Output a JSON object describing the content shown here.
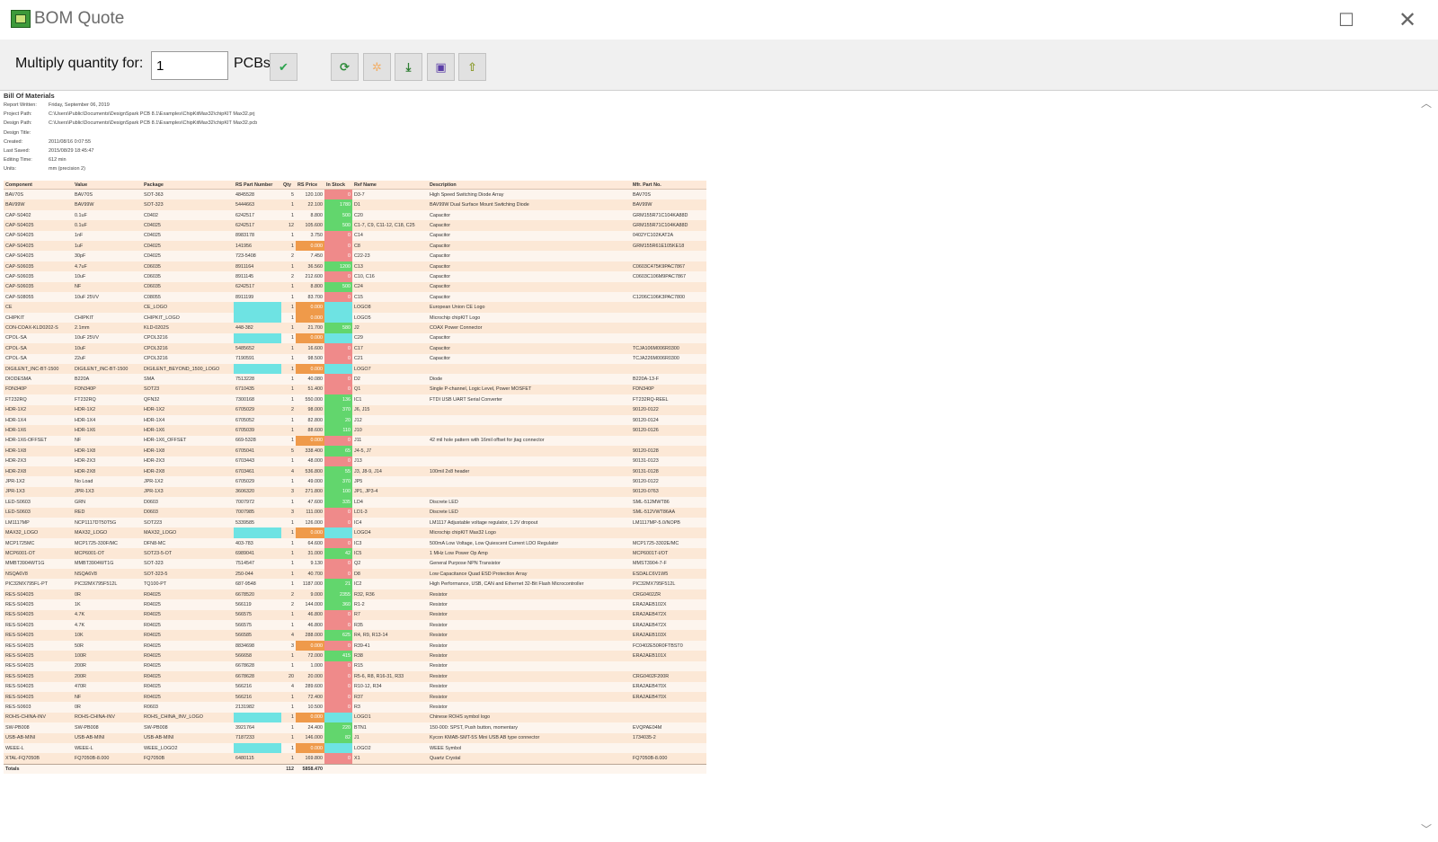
{
  "window": {
    "title": "BOM Quote"
  },
  "toolbar": {
    "multiply_label": "Multiply quantity for:",
    "quantity_value": "1",
    "pcbs_label": "PCBs"
  },
  "colors": {
    "toolbar_bg": "#f0f0f0",
    "header_bg": "#fde9d9",
    "stock_zero": "#ef8a8a",
    "stock_ok": "#62d66d",
    "missing": "#6ee3e3",
    "price_zero": "#ef9a4a"
  },
  "report": {
    "title": "Bill Of Materials",
    "meta": [
      {
        "k": "Report Written:",
        "v": "Friday, September 06, 2019"
      },
      {
        "k": "Project Path:",
        "v": "C:\\Users\\Public\\Documents\\DesignSpark PCB 8.1\\Examples\\ChipKitMax32\\chipKIT Max32.prj"
      },
      {
        "k": "Design Path:",
        "v": "C:\\Users\\Public\\Documents\\DesignSpark PCB 8.1\\Examples\\ChipKitMax32\\chipKIT Max32.pcb"
      },
      {
        "k": "Design Title:",
        "v": ""
      },
      {
        "k": "Created:",
        "v": "2011/08/16 0:07:55"
      },
      {
        "k": "Last Saved:",
        "v": "2015/08/29 18:45:47"
      },
      {
        "k": "Editing Time:",
        "v": "612 min"
      },
      {
        "k": "Units:",
        "v": "mm (precision 2)"
      }
    ]
  },
  "table": {
    "headers": [
      "Component",
      "Value",
      "Package",
      "RS Part Number",
      "Qty",
      "RS Price",
      "In Stock",
      "Ref Name",
      "Description",
      "Mfr. Part No."
    ],
    "rows": [
      [
        "BAV70S",
        "BAV70S",
        "SOT-363",
        "4845528",
        "5",
        "120.100",
        "0",
        "D3-7",
        "High Speed Switching Diode Array",
        "BAV70S"
      ],
      [
        "BAV99W",
        "BAV99W",
        "SOT-323",
        "5444663",
        "1",
        "22.100",
        "1780",
        "D1",
        "BAV99W Dual Surface Mount Switching Diode",
        "BAV99W"
      ],
      [
        "CAP-S0402",
        "0.1uF",
        "C0402",
        "6242517",
        "1",
        "8.800",
        "500",
        "C20",
        "Capacitor",
        "GRM155R71C104KA88D"
      ],
      [
        "CAP-S04025",
        "0.1uF",
        "C04025",
        "6242517",
        "12",
        "105.600",
        "500",
        "C1-7, C9, C11-12, C18, C25",
        "Capacitor",
        "GRM155R71C104KA88D"
      ],
      [
        "CAP-S04025",
        "1nF",
        "C04025",
        "8983178",
        "1",
        "3.750",
        "0",
        "C14",
        "Capacitor",
        "0402YC102KAT2A"
      ],
      [
        "CAP-S04025",
        "1uF",
        "C04025",
        "141956",
        "1",
        "0.000",
        "0",
        "C8",
        "Capacitor",
        "GRM155R61E105KE18"
      ],
      [
        "CAP-S04025",
        "30pF",
        "C04025",
        "723-5408",
        "2",
        "7.450",
        "0",
        "C22-23",
        "Capacitor",
        ""
      ],
      [
        "CAP-S06035",
        "4.7uF",
        "C06035",
        "8911164",
        "1",
        "36.560",
        "1200",
        "C13",
        "Capacitor",
        "C0603C475K9PAC7867"
      ],
      [
        "CAP-S06035",
        "10uF",
        "C06035",
        "8911145",
        "2",
        "212.600",
        "0",
        "C10, C16",
        "Capacitor",
        "C0603C106M9PAC7867"
      ],
      [
        "CAP-S06035",
        "NF",
        "C06035",
        "6242517",
        "1",
        "8.800",
        "500",
        "C24",
        "Capacitor",
        ""
      ],
      [
        "CAP-S08055",
        "10uF 25VV",
        "C08055",
        "8911199",
        "1",
        "83.700",
        "0",
        "C15",
        "Capacitor",
        "C1206C106K3PAC7800"
      ],
      [
        "CE",
        "",
        "CE_LOGO",
        "",
        "1",
        "0.000",
        "",
        "LOGO8",
        "European Union CE Logo",
        ""
      ],
      [
        "CHIPKIT",
        "CHIPKIT",
        "CHIPKIT_LOGO",
        "",
        "1",
        "0.000",
        "",
        "LOGO5",
        "Microchip chipKIT Logo",
        ""
      ],
      [
        "CON-COAX-KLD0202-S",
        "2.1mm",
        "KLD-0202S",
        "448-382",
        "1",
        "21.700",
        "580",
        "J2",
        "COAX Power Connector",
        ""
      ],
      [
        "CPOL-SA",
        "10uF 25VV",
        "CPOL3216",
        "",
        "1",
        "0.000",
        "",
        "C29",
        "Capacitor",
        ""
      ],
      [
        "CPOL-SA",
        "10uF",
        "CPOL3216",
        "5485652",
        "1",
        "16.600",
        "0",
        "C17",
        "Capacitor",
        "TCJA106M006R0300"
      ],
      [
        "CPOL-SA",
        "22uF",
        "CPOL3216",
        "7190591",
        "1",
        "98.500",
        "0",
        "C21",
        "Capacitor",
        "TCJA226M006R0300"
      ],
      [
        "DIGILENT_INC-BT-1500",
        "DIGILENT_INC-BT-1500",
        "DIGILENT_BEYOND_1500_LOGO",
        "",
        "1",
        "0.000",
        "",
        "LOGO7",
        "",
        ""
      ],
      [
        "DIODESMA",
        "B220A",
        "SMA",
        "7513228",
        "1",
        "40.080",
        "0",
        "D2",
        "Diode",
        "B220A-13-F"
      ],
      [
        "FDN340P",
        "FDN340P",
        "SOT23",
        "6710435",
        "1",
        "51.400",
        "0",
        "Q1",
        "Single P-channel, Logic Level, Power MOSFET",
        "FDN340P"
      ],
      [
        "FT232RQ",
        "FT232RQ",
        "QFN32",
        "7300168",
        "1",
        "550.000",
        "136",
        "IC1",
        "FTDI USB UART Serial Converter",
        "FT232RQ-REEL"
      ],
      [
        "HDR-1X2",
        "HDR-1X2",
        "HDR-1X2",
        "6705029",
        "2",
        "98.000",
        "370",
        "J6, J15",
        "",
        "90120-0122"
      ],
      [
        "HDR-1X4",
        "HDR-1X4",
        "HDR-1X4",
        "6705052",
        "1",
        "82.800",
        "20",
        "J12",
        "",
        "90120-0124"
      ],
      [
        "HDR-1X6",
        "HDR-1X6",
        "HDR-1X6",
        "6705039",
        "1",
        "88.600",
        "110",
        "J10",
        "",
        "90120-0126"
      ],
      [
        "HDR-1X6-OFFSET",
        "NF",
        "HDR-1X6_OFFSET",
        "669-5328",
        "1",
        "0.000",
        "0",
        "J11",
        "42 mil hole pattern with 16mil offset for jtag connector",
        ""
      ],
      [
        "HDR-1X8",
        "HDR-1X8",
        "HDR-1X8",
        "6705041",
        "5",
        "338.400",
        "65",
        "J4-5, J7",
        "",
        "90120-0128"
      ],
      [
        "HDR-2X3",
        "HDR-2X3",
        "HDR-2X3",
        "6703443",
        "1",
        "48.000",
        "0",
        "J13",
        "",
        "90131-0123"
      ],
      [
        "HDR-2X8",
        "HDR-2X8",
        "HDR-2X8",
        "6703461",
        "4",
        "536.800",
        "55",
        "J3, J8-9, J14",
        "100mil 2x8 header",
        "90131-0128"
      ],
      [
        "JPR-1X2",
        "No Load",
        "JPR-1X2",
        "6705029",
        "1",
        "49.000",
        "370",
        "JP5",
        "",
        "90120-0122"
      ],
      [
        "JPR-1X3",
        "JPR-1X3",
        "JPR-1X3",
        "3606320",
        "3",
        "271.800",
        "100",
        "JP1, JP3-4",
        "",
        "90120-0763"
      ],
      [
        "LED-S0603",
        "GRN",
        "D0603",
        "7007972",
        "1",
        "47.600",
        "335",
        "LD4",
        "Discrete LED",
        "SML-512MWT86"
      ],
      [
        "LED-S0603",
        "RED",
        "D0603",
        "7007985",
        "3",
        "111.000",
        "0",
        "LD1-3",
        "Discrete LED",
        "SML-512VWT86AA"
      ],
      [
        "LM1117MP",
        "NCP1117DT50T5G",
        "SOT223",
        "5339585",
        "1",
        "126.000",
        "0",
        "IC4",
        "LM1117 Adjustable voltage regulator, 1.2V dropout",
        "LM1117MP-5.0/NOPB"
      ],
      [
        "MAX32_LOGO",
        "MAX32_LOGO",
        "MAX32_LOGO",
        "",
        "1",
        "0.000",
        "",
        "LOGO4",
        "Microchip chipKIT Max32 Logo",
        ""
      ],
      [
        "MCP1725MC",
        "MCP1725-330F/MC",
        "DFN8-MC",
        "403-783",
        "1",
        "64.600",
        "0",
        "IC3",
        "500mA Low Voltage, Low Quiescent Current LDO Regulator",
        "MCP1725-3302E/MC"
      ],
      [
        "MCP6001-OT",
        "MCP6001-OT",
        "SOT23-5-OT",
        "6989041",
        "1",
        "31.000",
        "42",
        "IC5",
        "1 MHz Low Power Op Amp",
        "MCP6001T-I/OT"
      ],
      [
        "MMBT3904WT1G",
        "MMBT3904WT1G",
        "SOT-323",
        "7514547",
        "1",
        "9.130",
        "0",
        "Q2",
        "General Purpose NPN Transistor",
        "MMST3904-7-F"
      ],
      [
        "NSQA6V8",
        "NSQA6V8",
        "SOT-323-5",
        "250-044",
        "1",
        "40.700",
        "0",
        "D8",
        "Low Capacitance Quad ESD Protection Array",
        "ESDALC6V1W5"
      ],
      [
        "PIC32MX795FL-PT",
        "PIC32MX795F512L",
        "TQ100-PT",
        "687-9548",
        "1",
        "1187.000",
        "21",
        "IC2",
        "High Performance, USB, CAN and Ethernet 32-Bit Flash Microcontroller",
        "PIC32MX795F512L"
      ],
      [
        "RES-S04025",
        "0R",
        "R04025",
        "6678520",
        "2",
        "9.000",
        "2355",
        "R32, R36",
        "Resistor",
        "CRG0402ZR"
      ],
      [
        "RES-S04025",
        "1K",
        "R04025",
        "566119",
        "2",
        "144.000",
        "360",
        "R1-2",
        "Resistor",
        "ERA2AEB102X"
      ],
      [
        "RES-S04025",
        "4.7K",
        "R04025",
        "566575",
        "1",
        "46.800",
        "0",
        "R7",
        "Resistor",
        "ERA2AEB472X"
      ],
      [
        "RES-S04025",
        "4.7K",
        "R04025",
        "566575",
        "1",
        "46.800",
        "0",
        "R35",
        "Resistor",
        "ERA2AEB472X"
      ],
      [
        "RES-S04025",
        "10K",
        "R04025",
        "566585",
        "4",
        "288.000",
        "625",
        "R4, R9, R13-14",
        "Resistor",
        "ERA2AEB103X"
      ],
      [
        "RES-S04025",
        "50R",
        "R04025",
        "8834698",
        "3",
        "0.000",
        "0",
        "R39-41",
        "Resistor",
        "FC0402E50R0FTBST0"
      ],
      [
        "RES-S04025",
        "100R",
        "R04025",
        "566658",
        "1",
        "72.000",
        "415",
        "R38",
        "Resistor",
        "ERA2AEB101X"
      ],
      [
        "RES-S04025",
        "200R",
        "R04025",
        "6678628",
        "1",
        "1.000",
        "0",
        "R15",
        "Resistor",
        ""
      ],
      [
        "RES-S04025",
        "200R",
        "R04025",
        "6678628",
        "20",
        "20.000",
        "0",
        "R5-6, R8, R16-31, R33",
        "Resistor",
        "CRG0402F200R"
      ],
      [
        "RES-S04025",
        "470R",
        "R04025",
        "566216",
        "4",
        "289.600",
        "0",
        "R10-12, R34",
        "Resistor",
        "ERA2AEB470X"
      ],
      [
        "RES-S04025",
        "NF",
        "R04025",
        "566216",
        "1",
        "72.400",
        "0",
        "R37",
        "Resistor",
        "ERA2AEB470X"
      ],
      [
        "RES-S0603",
        "0R",
        "R0603",
        "2131982",
        "1",
        "10.500",
        "0",
        "R3",
        "Resistor",
        ""
      ],
      [
        "ROHS-CHINA-INV",
        "ROHS-CHINA-INV",
        "ROHS_CHINA_INV_LOGO",
        "",
        "1",
        "0.000",
        "",
        "LOGO1",
        "Chinese ROHS symbol logo",
        ""
      ],
      [
        "SW-PB008",
        "SW-PB008",
        "SW-PB008",
        "3921764",
        "1",
        "24.400",
        "220",
        "BTN1",
        "150-000: SPST, Push button, momentary",
        "EVQPAE04M"
      ],
      [
        "USB-AB-MINI",
        "USB-AB-MINI",
        "USB-AB-MINI",
        "7187233",
        "1",
        "146.000",
        "82",
        "J1",
        "Kycon KMAB-SMT-5S Mini USB AB type connector",
        "1734035-2"
      ],
      [
        "WEEE-L",
        "WEEE-L",
        "WEEE_LOGO2",
        "",
        "1",
        "0.000",
        "",
        "LOGO2",
        "WEEE Symbol",
        ""
      ],
      [
        "XTAL-FQ7050B",
        "FQ7050B-8.000",
        "FQ7050B",
        "6480115",
        "1",
        "169.800",
        "0",
        "X1",
        "Quartz Crystal",
        "FQ7050B-8.000"
      ]
    ],
    "totals": {
      "label": "Totals",
      "qty": "112",
      "price": "5858.470"
    }
  }
}
